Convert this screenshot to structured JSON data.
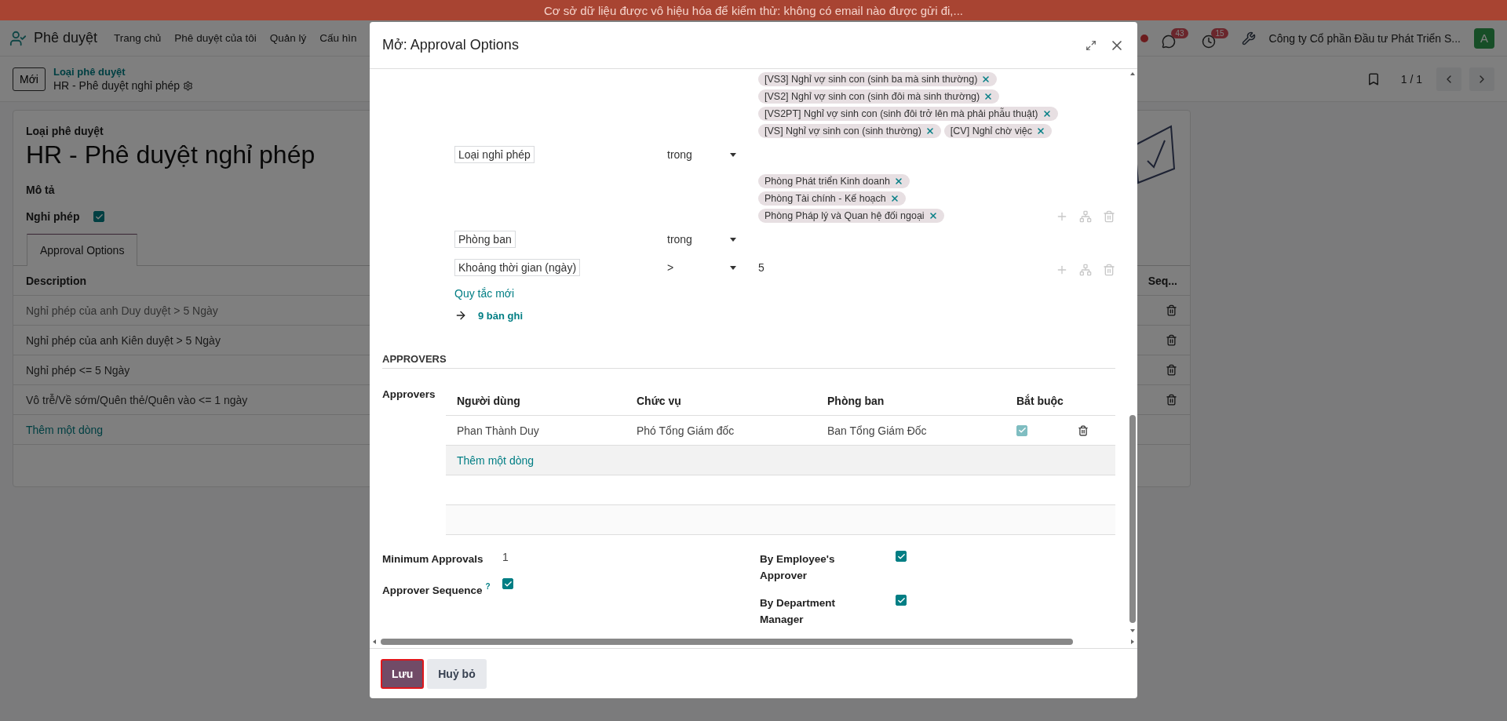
{
  "banner": "Cơ sở dữ liệu được vô hiệu hóa để kiểm thử: không có email nào được gửi đi,...",
  "navbar": {
    "app": "Phê duyệt",
    "menus": [
      "Trang chủ",
      "Phê duyệt của tôi",
      "Quản lý",
      "Cấu hìn"
    ],
    "messages_badge": "43",
    "activities_badge": "15",
    "company": "Công ty Cổ phần Đầu tư Phát Triển S...",
    "avatar": "A"
  },
  "control_panel": {
    "new_button": "Mới",
    "breadcrumb": "Loại phê duyệt",
    "record": "HR - Phê duyệt nghỉ phép",
    "pager": "1 / 1"
  },
  "form": {
    "type_label": "Loại phê duyệt",
    "title": "HR - Phê duyệt nghỉ phép",
    "description_label": "Mô tả",
    "leave_label": "Nghỉ phép",
    "leave_checked": true,
    "tabs": [
      {
        "label": "Approval Options",
        "selected": true
      }
    ],
    "columns": [
      "Description",
      "Seq..."
    ],
    "rows": [
      "Nghỉ phép của anh Duy duyệt > 5 Ngày",
      "Nghỉ phép của anh Kiên duyệt > 5 Ngày",
      "Nghỉ phép <= 5 Ngày",
      "Vô trễ/Về sớm/Quên thẻ/Quên vào <= 1 ngày"
    ],
    "add_line": "Thêm một dòng"
  },
  "dialog": {
    "title": "Mở: Approval Options",
    "rules": [
      {
        "kind": "tags",
        "path": "Loại nghỉ phép",
        "operator": "trong",
        "tags": [
          "[VS3] Nghỉ vợ sinh con (sinh ba mà sinh thường)",
          "[VS2] Nghỉ vợ sinh con (sinh đôi mà sinh thường)",
          "[VS2PT] Nghỉ vợ sinh con (sinh đôi trở lên mà phải phẫu thuật)",
          "[VS] Nghỉ vợ sinh con (sinh thường)",
          "[CV] Nghỉ chờ việc"
        ],
        "actions": false
      },
      {
        "kind": "tags",
        "path": "Phòng ban",
        "operator": "trong",
        "tags": [
          "Phòng Phát triển Kinh doanh",
          "Phòng Tài chính - Kế hoạch",
          "Phòng Pháp lý và Quan hệ đối ngoại"
        ],
        "actions": true
      },
      {
        "kind": "value",
        "path": "Khoảng thời gian (ngày)",
        "operator": ">",
        "value": "5",
        "actions": true
      }
    ],
    "new_rule": "Quy tắc mới",
    "records": "9 bản ghi",
    "section": "APPROVERS",
    "approvers_label": "Approvers",
    "approver_columns": [
      "Người dùng",
      "Chức vụ",
      "Phòng ban",
      "Bắt buộc"
    ],
    "approvers": [
      {
        "cells": [
          "Phan Thành Duy",
          "Phó Tổng Giám đốc",
          "Ban Tổng Giám Đốc"
        ],
        "required": true,
        "disabled": true
      }
    ],
    "add_line": "Thêm một dòng",
    "settings_left": [
      {
        "kind": "value",
        "label": "Minimum Approvals",
        "value": "1"
      },
      {
        "kind": "checkbox",
        "label": "Approver Sequence",
        "help": "?",
        "checked": true
      }
    ],
    "settings_right": [
      {
        "kind": "checkbox",
        "label": "By Employee's Approver",
        "checked": true
      },
      {
        "kind": "checkbox",
        "label": "By Department Manager",
        "checked": true
      }
    ],
    "buttons": [
      {
        "label": "Lưu",
        "kind": "primary"
      },
      {
        "label": "Huỷ bỏ",
        "kind": "secondary"
      }
    ]
  }
}
